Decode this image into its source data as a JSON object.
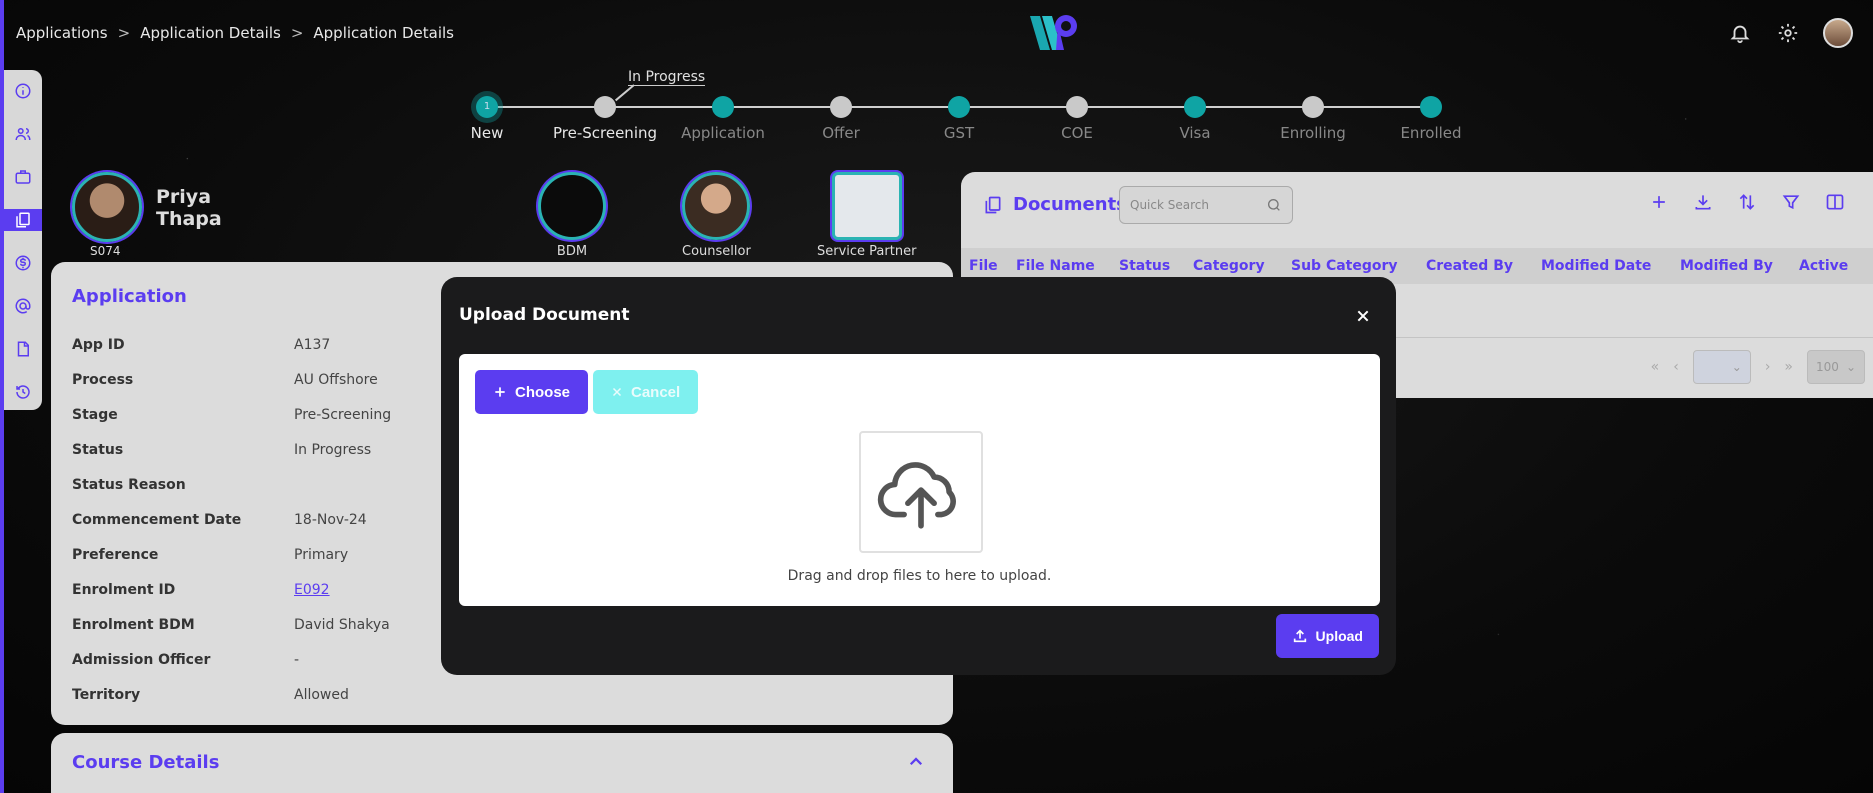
{
  "breadcrumb": [
    "Applications",
    "Application Details",
    "Application Details"
  ],
  "breadcrumb_sep": ">",
  "stepper": {
    "in_progress_label": "In Progress",
    "current_index_label": "1",
    "steps": [
      {
        "label": "New",
        "state": "current"
      },
      {
        "label": "Pre-Screening",
        "state": "grey"
      },
      {
        "label": "Application",
        "state": "teal"
      },
      {
        "label": "Offer",
        "state": "grey"
      },
      {
        "label": "GST",
        "state": "teal"
      },
      {
        "label": "COE",
        "state": "grey"
      },
      {
        "label": "Visa",
        "state": "teal"
      },
      {
        "label": "Enrolling",
        "state": "grey"
      },
      {
        "label": "Enrolled",
        "state": "teal"
      }
    ]
  },
  "person": {
    "first": "Priya",
    "last": "Thapa",
    "code": "S074"
  },
  "team": {
    "bdm": "BDM",
    "counsellor": "Counsellor",
    "service_partner": "Service Partner"
  },
  "application": {
    "title": "Application",
    "rows": [
      {
        "k": "App ID",
        "v": "A137"
      },
      {
        "k": "Process",
        "v": "AU Offshore"
      },
      {
        "k": "Stage",
        "v": "Pre-Screening"
      },
      {
        "k": "Status",
        "v": "In Progress"
      },
      {
        "k": "Status Reason",
        "v": ""
      },
      {
        "k": "Commencement Date",
        "v": "18-Nov-24"
      },
      {
        "k": "Preference",
        "v": "Primary"
      },
      {
        "k": "Enrolment ID",
        "v": "E092"
      },
      {
        "k": "Enrolment BDM",
        "v": "David Shakya"
      },
      {
        "k": "Admission Officer",
        "v": "-"
      },
      {
        "k": "Territory",
        "v": "Allowed"
      }
    ]
  },
  "course": {
    "title": "Course Details"
  },
  "documents": {
    "title": "Documents",
    "search_placeholder": "Quick Search",
    "columns": [
      "File",
      "File Name",
      "Status",
      "Category",
      "Sub Category",
      "Created By",
      "Modified Date",
      "Modified By",
      "Active"
    ],
    "page_size": "100"
  },
  "modal": {
    "title": "Upload Document",
    "choose_label": "Choose",
    "cancel_label": "Cancel",
    "drag_text": "Drag and drop files to here to upload.",
    "upload_label": "Upload"
  },
  "colors": {
    "accent": "#5b3df0",
    "teal": "#0fa4a4",
    "cancel": "#7ef0ef"
  }
}
